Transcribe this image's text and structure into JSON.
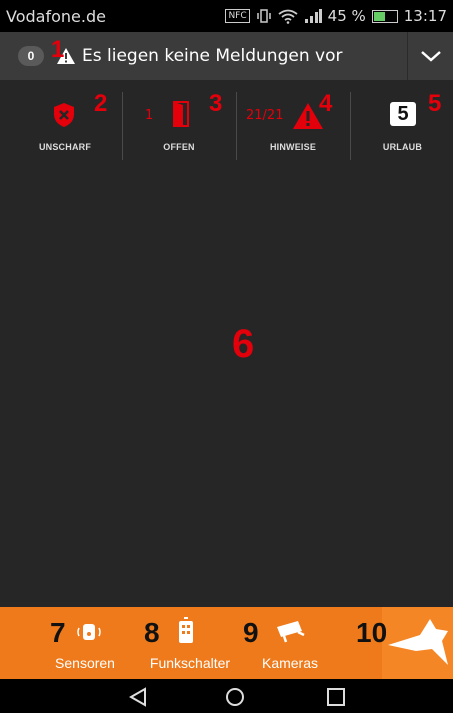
{
  "status_bar": {
    "carrier": "Vodafone.de",
    "battery": "45 %",
    "time": "13:17",
    "nfc": "NFC"
  },
  "message_bar": {
    "count": "0",
    "text": "Es liegen keine Meldungen vor"
  },
  "status_items": {
    "unscharf": {
      "label": "UNSCHARF"
    },
    "offen": {
      "label": "OFFEN",
      "count": "1"
    },
    "hinweise": {
      "label": "HINWEISE",
      "count": "21/21"
    },
    "urlaub": {
      "label": "URLAUB",
      "value": "5"
    }
  },
  "bottom_bar": {
    "sensoren": {
      "label": "Sensoren"
    },
    "funkschalter": {
      "label": "Funkschalter"
    },
    "kameras": {
      "label": "Kameras"
    }
  },
  "annotations": [
    "1",
    "2",
    "3",
    "4",
    "5",
    "6",
    "7",
    "8",
    "9",
    "10"
  ],
  "colors": {
    "accent_orange": "#ee7a1b",
    "alert_red": "#e3000b",
    "background": "#262626"
  }
}
